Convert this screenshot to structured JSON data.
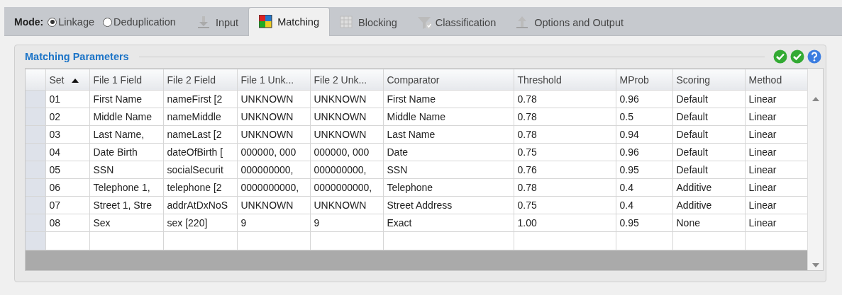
{
  "mode": {
    "label": "Mode:",
    "options": [
      {
        "label": "Linkage",
        "selected": true
      },
      {
        "label": "Deduplication",
        "selected": false
      }
    ]
  },
  "tabs": [
    {
      "label": "Input",
      "selected": false
    },
    {
      "label": "Matching",
      "selected": true
    },
    {
      "label": "Blocking",
      "selected": false
    },
    {
      "label": "Classification",
      "selected": false
    },
    {
      "label": "Options and Output",
      "selected": false
    }
  ],
  "panel": {
    "title": "Matching Parameters",
    "table": {
      "columns": [
        {
          "label": "Set",
          "sorted_ascending": true
        },
        {
          "label": "File 1 Field"
        },
        {
          "label": "File 2 Field"
        },
        {
          "label": "File 1 Unk..."
        },
        {
          "label": "File 2 Unk..."
        },
        {
          "label": "Comparator"
        },
        {
          "label": "Threshold"
        },
        {
          "label": "MProb"
        },
        {
          "label": "Scoring"
        },
        {
          "label": "Method"
        }
      ],
      "rows": [
        [
          "01",
          "First Name",
          "nameFirst [2",
          "UNKNOWN",
          "UNKNOWN",
          "First Name",
          "0.78",
          "0.96",
          "Default",
          "Linear"
        ],
        [
          "02",
          "Middle Name",
          "nameMiddle",
          "UNKNOWN",
          "UNKNOWN",
          "Middle Name",
          "0.78",
          "0.5",
          "Default",
          "Linear"
        ],
        [
          "03",
          "Last Name,",
          "nameLast [2",
          "UNKNOWN",
          "UNKNOWN",
          "Last Name",
          "0.78",
          "0.94",
          "Default",
          "Linear"
        ],
        [
          "04",
          "Date Birth",
          "dateOfBirth [",
          "000000, 000",
          "000000, 000",
          "Date",
          "0.75",
          "0.96",
          "Default",
          "Linear"
        ],
        [
          "05",
          "SSN",
          "socialSecurit",
          "000000000,",
          "000000000,",
          "SSN",
          "0.76",
          "0.95",
          "Default",
          "Linear"
        ],
        [
          "06",
          "Telephone 1,",
          "telephone [2",
          "0000000000,",
          "0000000000,",
          "Telephone",
          "0.78",
          "0.4",
          "Additive",
          "Linear"
        ],
        [
          "07",
          "Street 1, Stre",
          "addrAtDxNoS",
          "UNKNOWN",
          "UNKNOWN",
          "Street Address",
          "0.75",
          "0.4",
          "Additive",
          "Linear"
        ],
        [
          "08",
          "Sex",
          "sex [220]",
          "9",
          "9",
          "Exact",
          "1.00",
          "0.95",
          "None",
          "Linear"
        ]
      ]
    }
  }
}
